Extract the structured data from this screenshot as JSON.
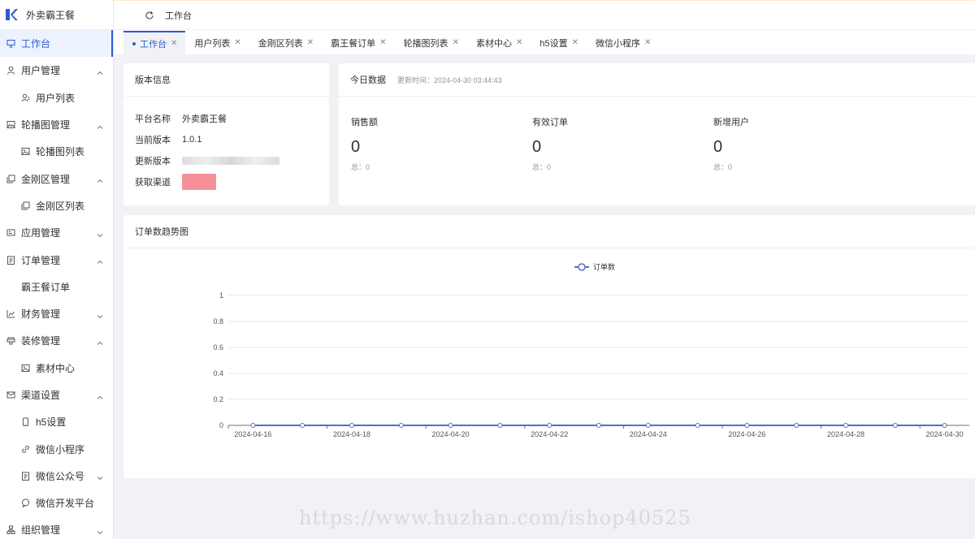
{
  "app": {
    "name": "外卖霸王餐"
  },
  "sidebar": {
    "items": [
      {
        "label": "工作台",
        "icon": "monitor-icon",
        "active": true
      },
      {
        "label": "用户管理",
        "icon": "user-icon",
        "caret": "up"
      },
      {
        "label": "用户列表",
        "icon": "user-list-icon",
        "sub": true
      },
      {
        "label": "轮播图管理",
        "icon": "image-icon",
        "caret": "up"
      },
      {
        "label": "轮播图列表",
        "icon": "picture-icon",
        "sub": true
      },
      {
        "label": "金刚区管理",
        "icon": "copy-icon",
        "caret": "up"
      },
      {
        "label": "金刚区列表",
        "icon": "copy-icon",
        "sub": true
      },
      {
        "label": "应用管理",
        "icon": "app-icon",
        "caret": "down"
      },
      {
        "label": "订单管理",
        "icon": "document-icon",
        "caret": "up"
      },
      {
        "label": "霸王餐订单",
        "icon": "",
        "sub": true
      },
      {
        "label": "财务管理",
        "icon": "chart-icon",
        "caret": "down"
      },
      {
        "label": "装修管理",
        "icon": "brush-icon",
        "caret": "up"
      },
      {
        "label": "素材中心",
        "icon": "picture-icon",
        "sub": true
      },
      {
        "label": "渠道设置",
        "icon": "mail-icon",
        "caret": "up"
      },
      {
        "label": "h5设置",
        "icon": "phone-icon",
        "sub": true
      },
      {
        "label": "微信小程序",
        "icon": "link-icon",
        "sub": true
      },
      {
        "label": "微信公众号",
        "icon": "document-icon",
        "sub": true,
        "caret": "down"
      },
      {
        "label": "微信开发平台",
        "icon": "chat-icon",
        "sub": true
      },
      {
        "label": "组织管理",
        "icon": "org-icon",
        "caret": "down"
      }
    ]
  },
  "topbar": {
    "title": "工作台"
  },
  "tabs": [
    {
      "label": "工作台",
      "active": true
    },
    {
      "label": "用户列表"
    },
    {
      "label": "金刚区列表"
    },
    {
      "label": "霸王餐订单"
    },
    {
      "label": "轮播图列表"
    },
    {
      "label": "素材中心"
    },
    {
      "label": "h5设置"
    },
    {
      "label": "微信小程序"
    }
  ],
  "version_card": {
    "title": "版本信息",
    "rows": [
      {
        "key": "平台名称",
        "value": "外卖霸王餐"
      },
      {
        "key": "当前版本",
        "value": "1.0.1"
      },
      {
        "key": "更新版本",
        "value": ""
      },
      {
        "key": "获取渠道",
        "value": ""
      }
    ]
  },
  "today_card": {
    "title": "今日数据",
    "updated": "更新时间：2024-04-30 03:44:43",
    "stats": [
      {
        "label": "销售额",
        "value": "0",
        "total": "总：0"
      },
      {
        "label": "有效订单",
        "value": "0",
        "total": "总：0"
      },
      {
        "label": "新增用户",
        "value": "0",
        "total": "总：0"
      }
    ]
  },
  "trend_card": {
    "title": "订单数趋势图"
  },
  "chart_data": {
    "type": "line",
    "legend_position": "top-center",
    "x": [
      "2024-04-16",
      "2024-04-17",
      "2024-04-18",
      "2024-04-19",
      "2024-04-20",
      "2024-04-21",
      "2024-04-22",
      "2024-04-23",
      "2024-04-24",
      "2024-04-25",
      "2024-04-26",
      "2024-04-27",
      "2024-04-28",
      "2024-04-29",
      "2024-04-30"
    ],
    "x_tick_labels": [
      "2024-04-16",
      "2024-04-18",
      "2024-04-20",
      "2024-04-22",
      "2024-04-24",
      "2024-04-26",
      "2024-04-28",
      "2024-04-30"
    ],
    "y_tick_labels": [
      "0",
      "0.2",
      "0.4",
      "0.6",
      "0.8",
      "1"
    ],
    "ylim": [
      0,
      1
    ],
    "grid": true,
    "series": [
      {
        "name": "订单数",
        "color": "#5470c6",
        "values": [
          0,
          0,
          0,
          0,
          0,
          0,
          0,
          0,
          0,
          0,
          0,
          0,
          0,
          0,
          0
        ]
      }
    ]
  },
  "watermark": "https://www.huzhan.com/ishop40525"
}
